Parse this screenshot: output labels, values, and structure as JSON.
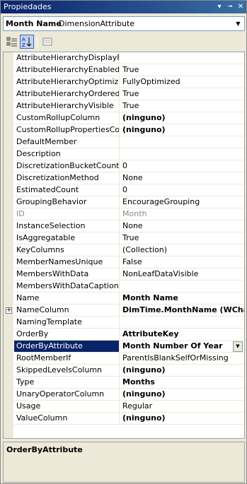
{
  "window": {
    "title": "Propiedades"
  },
  "titlebar_buttons": [
    "▾",
    "╼",
    "✕"
  ],
  "object": {
    "name": "Month Name",
    "type": "DimensionAttribute"
  },
  "toolbar": {
    "categorized_icon": "categorized-icon",
    "alphabetical_icon": "alphabetical-icon",
    "property_pages_icon": "property-pages-icon"
  },
  "properties": [
    {
      "name": "AttributeHierarchyDisplayFolder",
      "value": "",
      "bold": false
    },
    {
      "name": "AttributeHierarchyEnabled",
      "value": "True",
      "bold": false
    },
    {
      "name": "AttributeHierarchyOptimizedState",
      "value": "FullyOptimized",
      "bold": false
    },
    {
      "name": "AttributeHierarchyOrdered",
      "value": "True",
      "bold": false
    },
    {
      "name": "AttributeHierarchyVisible",
      "value": "True",
      "bold": false
    },
    {
      "name": "CustomRollupColumn",
      "value": "(ninguno)",
      "bold": true
    },
    {
      "name": "CustomRollupPropertiesColumn",
      "value": "(ninguno)",
      "bold": true
    },
    {
      "name": "DefaultMember",
      "value": "",
      "bold": false
    },
    {
      "name": "Description",
      "value": "",
      "bold": false
    },
    {
      "name": "DiscretizationBucketCount",
      "value": "0",
      "bold": false
    },
    {
      "name": "DiscretizationMethod",
      "value": "None",
      "bold": false
    },
    {
      "name": "EstimatedCount",
      "value": "0",
      "bold": false
    },
    {
      "name": "GroupingBehavior",
      "value": "EncourageGrouping",
      "bold": false
    },
    {
      "name": "ID",
      "value": "Month",
      "bold": false,
      "disabled": true
    },
    {
      "name": "InstanceSelection",
      "value": "None",
      "bold": false
    },
    {
      "name": "IsAggregatable",
      "value": "True",
      "bold": false
    },
    {
      "name": "KeyColumns",
      "value": "(Collection)",
      "bold": false
    },
    {
      "name": "MemberNamesUnique",
      "value": "False",
      "bold": false
    },
    {
      "name": "MembersWithData",
      "value": "NonLeafDataVisible",
      "bold": false
    },
    {
      "name": "MembersWithDataCaption",
      "value": "",
      "bold": false
    },
    {
      "name": "Name",
      "value": "Month Name",
      "bold": true
    },
    {
      "name": "NameColumn",
      "value": "DimTime.MonthName (WChar)",
      "bold": true,
      "expandable": true
    },
    {
      "name": "NamingTemplate",
      "value": "",
      "bold": false
    },
    {
      "name": "OrderBy",
      "value": "AttributeKey",
      "bold": true
    },
    {
      "name": "OrderByAttribute",
      "value": "Month Number Of Year",
      "bold": true,
      "selected": true
    },
    {
      "name": "RootMemberIf",
      "value": "ParentIsBlankSelfOrMissing",
      "bold": false
    },
    {
      "name": "SkippedLevelsColumn",
      "value": "(ninguno)",
      "bold": true
    },
    {
      "name": "Type",
      "value": "Months",
      "bold": true
    },
    {
      "name": "UnaryOperatorColumn",
      "value": "(ninguno)",
      "bold": true
    },
    {
      "name": "Usage",
      "value": "Regular",
      "bold": false
    },
    {
      "name": "ValueColumn",
      "value": "(ninguno)",
      "bold": true
    }
  ],
  "description": {
    "title": "OrderByAttribute"
  },
  "colors": {
    "selection": "#0a246a",
    "titlebar": "#0a246a",
    "disabled_text": "#8c8c8c"
  }
}
